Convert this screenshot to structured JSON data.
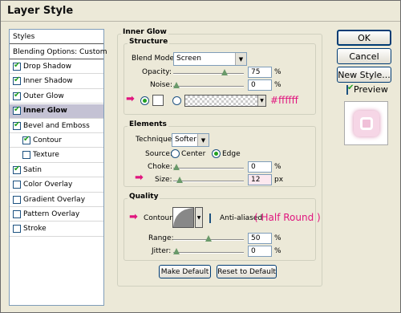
{
  "window": {
    "title": "Layer Style"
  },
  "styles_list": {
    "header": "Styles",
    "items": [
      {
        "label": "Blending Options: Custom",
        "checkbox": null,
        "selected": false,
        "bold": false
      },
      {
        "label": "Drop Shadow",
        "checkbox": true,
        "selected": false
      },
      {
        "label": "Inner Shadow",
        "checkbox": true,
        "selected": false
      },
      {
        "label": "Outer Glow",
        "checkbox": true,
        "selected": false
      },
      {
        "label": "Inner Glow",
        "checkbox": true,
        "selected": true
      },
      {
        "label": "Bevel and Emboss",
        "checkbox": true,
        "selected": false
      },
      {
        "label": "Contour",
        "checkbox": true,
        "selected": false,
        "indent": true
      },
      {
        "label": "Texture",
        "checkbox": false,
        "selected": false,
        "indent": true
      },
      {
        "label": "Satin",
        "checkbox": true,
        "selected": false
      },
      {
        "label": "Color Overlay",
        "checkbox": false,
        "selected": false
      },
      {
        "label": "Gradient Overlay",
        "checkbox": false,
        "selected": false
      },
      {
        "label": "Pattern Overlay",
        "checkbox": false,
        "selected": false
      },
      {
        "label": "Stroke",
        "checkbox": false,
        "selected": false
      }
    ]
  },
  "inner_glow": {
    "group_title": "Inner Glow",
    "structure": {
      "title": "Structure",
      "blend_mode_label": "Blend Mode:",
      "blend_mode_value": "Screen",
      "opacity_label": "Opacity:",
      "opacity_value": "75",
      "opacity_fill": 0.75,
      "noise_label": "Noise:",
      "noise_value": "0",
      "noise_fill": 0.0,
      "percent": "%",
      "color_annotation": "#ffffff",
      "glow_color": "#ffffff"
    },
    "elements": {
      "title": "Elements",
      "technique_label": "Technique:",
      "technique_value": "Softer",
      "source_label": "Source:",
      "source_center": "Center",
      "source_edge": "Edge",
      "source_selected": "Edge",
      "choke_label": "Choke:",
      "choke_value": "0",
      "choke_fill": 0.0,
      "size_label": "Size:",
      "size_value": "12",
      "size_fill": 0.048,
      "px": "px",
      "percent": "%"
    },
    "quality": {
      "title": "Quality",
      "contour_label": "Contour:",
      "anti_aliased_label": "Anti-aliased",
      "anti_aliased": false,
      "contour_annotation": "( Half Round )",
      "range_label": "Range:",
      "range_value": "50",
      "range_fill": 0.5,
      "jitter_label": "Jitter:",
      "jitter_value": "0",
      "jitter_fill": 0.0,
      "percent": "%"
    },
    "make_default": "Make Default",
    "reset_default": "Reset to Default"
  },
  "buttons": {
    "ok": "OK",
    "cancel": "Cancel",
    "new_style": "New Style...",
    "preview_label": "Preview",
    "preview_checked": true
  },
  "colors": {
    "annotation_pink": "#e0157e",
    "selected_row": "#c4c2d4",
    "dialog_bg": "#ece9d8"
  }
}
